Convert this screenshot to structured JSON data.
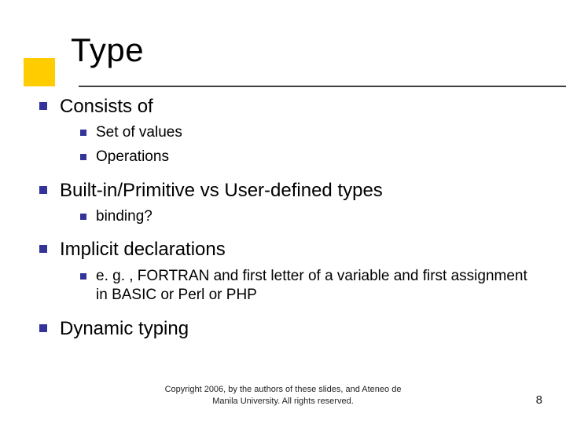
{
  "title": "Type",
  "bullets": [
    {
      "text": "Consists of",
      "children": [
        {
          "text": "Set of values"
        },
        {
          "text": "Operations"
        }
      ]
    },
    {
      "text": "Built-in/Primitive vs User-defined types",
      "children": [
        {
          "text": "binding?"
        }
      ]
    },
    {
      "text": "Implicit declarations",
      "children": [
        {
          "text": "e. g. , FORTRAN and first letter of a variable and first assignment in BASIC or Perl or PHP"
        }
      ]
    },
    {
      "text": "Dynamic typing",
      "children": []
    }
  ],
  "footer": {
    "line1": "Copyright 2006, by the authors of these slides, and Ateneo de",
    "line2": "Manila University. All rights reserved."
  },
  "page_number": "8"
}
